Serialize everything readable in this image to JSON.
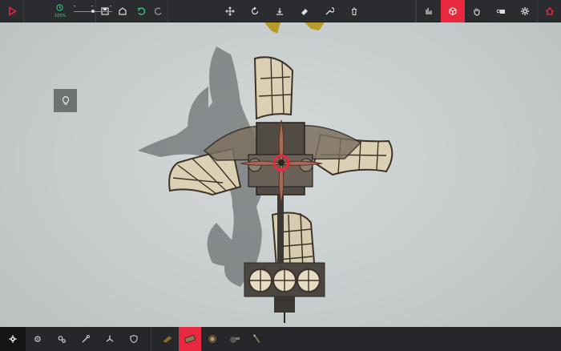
{
  "topbar": {
    "play_icon": "play-icon",
    "time_scale": {
      "icon": "clock-icon",
      "percent_label": "100%",
      "value_percent": 100
    },
    "file_tools": [
      "save-icon",
      "load-icon",
      "undo-icon",
      "redo-icon"
    ],
    "edit_tools": [
      "move-icon",
      "rotate-icon",
      "center-icon",
      "eraser-icon",
      "wrench-icon",
      "trash-icon"
    ],
    "right_tools": [
      "stats-icon",
      "block-view-icon",
      "grab-icon",
      "key-bind-icon",
      "settings-icon",
      "home-icon"
    ]
  },
  "bottombar": {
    "categories": [
      "settings-icon",
      "gear-icon",
      "cogs-icon",
      "wrench-icon",
      "propeller-icon",
      "shield-icon"
    ],
    "blocks": [
      "wooden-block-icon",
      "cannon-icon",
      "wheel-icon",
      "flamethrower-icon",
      "brace-icon"
    ],
    "selected_block": 1
  },
  "hint": {
    "icon": "lightbulb-icon"
  },
  "colors": {
    "accent": "#e8283c",
    "time_green": "#3fd28c",
    "bar": "#2b2c2f",
    "ground": "#c9cfcf"
  }
}
